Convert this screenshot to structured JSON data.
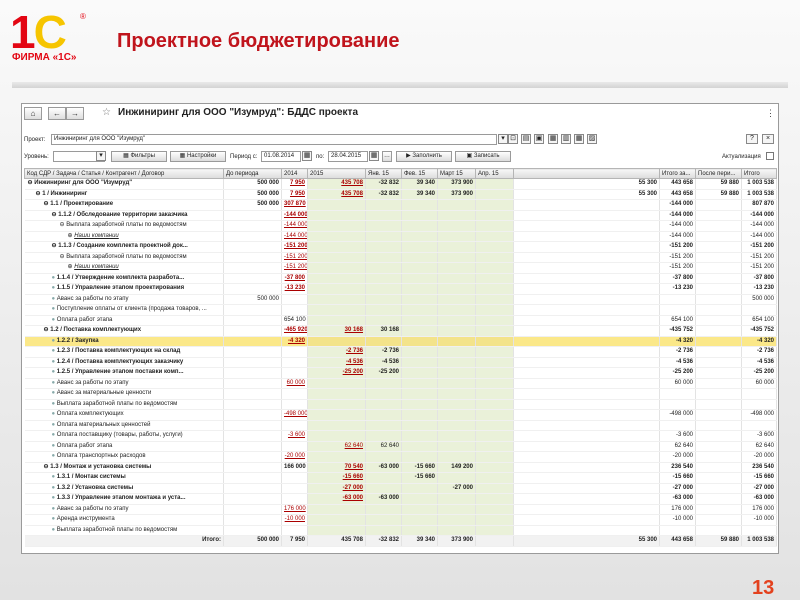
{
  "logo": {
    "mark": "1С",
    "sub": "ФИРМА «1С»"
  },
  "slide": {
    "title": "Проектное бюджетирование",
    "page": "13"
  },
  "window": {
    "title": "Инжиниринг для ООО \"Изумруд\": БДДС проекта",
    "help": "?",
    "close": "×"
  },
  "form": {
    "project_label": "Проект:",
    "project_value": "Инжиниринг для ООО \"Изумруд\"",
    "level_label": "Уровень:",
    "filters": "Фильтры",
    "settings": "Настройки",
    "period_label": "Период с:",
    "date_from": "01.08.2014",
    "date_to_label": "по:",
    "date_to": "28.04.2015",
    "fill": "Заполнить",
    "write": "Записать",
    "actual_label": "Актуализация"
  },
  "columns": [
    "Код СДР / Задача / Статья / Контрагент / Договор",
    "До периода",
    "2014",
    "2015",
    "Янв. 15",
    "Фев. 15",
    "Март 15",
    "Апр. 15",
    "",
    "Итого за...",
    "После пери...",
    "Итого"
  ],
  "rows": [
    {
      "n": "Инжиниринг для ООО \"Изумруд\"",
      "l": 0,
      "b": true,
      "v": [
        "500 000",
        "7 950",
        "435 708",
        "-32 832",
        "39 340",
        "373 900",
        "",
        "55 300",
        "443 658",
        "59 880",
        "1 003 538"
      ],
      "u": [
        false,
        true,
        true,
        false,
        false,
        false,
        false,
        false,
        false,
        false,
        false
      ]
    },
    {
      "n": "1 / Инжиниринг",
      "l": 1,
      "b": true,
      "v": [
        "500 000",
        "7 950",
        "435 708",
        "-32 832",
        "39 340",
        "373 900",
        "",
        "55 300",
        "443 658",
        "59 880",
        "1 003 538"
      ],
      "u": [
        false,
        true,
        true,
        false,
        false,
        false,
        false,
        false,
        false,
        false,
        false
      ]
    },
    {
      "n": "1.1 / Проектирование",
      "l": 2,
      "b": true,
      "v": [
        "500 000",
        "307 870",
        "",
        "",
        "",
        "",
        "",
        "",
        "-144 000",
        "",
        "807 870"
      ],
      "u": [
        false,
        true,
        false,
        false,
        false,
        false,
        false,
        false,
        false,
        false,
        false
      ]
    },
    {
      "n": "1.1.2 / Обследование территории заказчика",
      "l": 3,
      "b": true,
      "v": [
        "",
        "-144 000",
        "",
        "",
        "",
        "",
        "",
        "",
        "-144 000",
        "",
        "-144 000"
      ],
      "u": [
        false,
        true,
        false,
        false,
        false,
        false,
        false,
        false,
        false,
        false,
        false
      ]
    },
    {
      "n": "Выплата заработной платы по ведомостям",
      "l": 4,
      "b": false,
      "v": [
        "",
        "-144 000",
        "",
        "",
        "",
        "",
        "",
        "",
        "-144 000",
        "",
        "-144 000"
      ],
      "u": [
        false,
        true,
        false,
        false,
        false,
        false,
        false,
        false,
        false,
        false,
        false
      ]
    },
    {
      "n": "Наши компании",
      "l": 5,
      "b": false,
      "i": true,
      "v": [
        "",
        "-144 000",
        "",
        "",
        "",
        "",
        "",
        "",
        "-144 000",
        "",
        "-144 000"
      ],
      "u": [
        false,
        true,
        false,
        false,
        false,
        false,
        false,
        false,
        false,
        false,
        false
      ]
    },
    {
      "n": "1.1.3 / Создание комплекта проектной док...",
      "l": 3,
      "b": true,
      "v": [
        "",
        "-151 200",
        "",
        "",
        "",
        "",
        "",
        "",
        "-151 200",
        "",
        "-151 200"
      ],
      "u": [
        false,
        true,
        false,
        false,
        false,
        false,
        false,
        false,
        false,
        false,
        false
      ]
    },
    {
      "n": "Выплата заработной платы по ведомостям",
      "l": 4,
      "b": false,
      "v": [
        "",
        "-151 200",
        "",
        "",
        "",
        "",
        "",
        "",
        "-151 200",
        "",
        "-151 200"
      ],
      "u": [
        false,
        true,
        false,
        false,
        false,
        false,
        false,
        false,
        false,
        false,
        false
      ]
    },
    {
      "n": "Наши компании",
      "l": 5,
      "b": false,
      "i": true,
      "v": [
        "",
        "-151 200",
        "",
        "",
        "",
        "",
        "",
        "",
        "-151 200",
        "",
        "-151 200"
      ],
      "u": [
        false,
        true,
        false,
        false,
        false,
        false,
        false,
        false,
        false,
        false,
        false
      ]
    },
    {
      "n": "1.1.4 / Утверждение комплекта разработа...",
      "l": 3,
      "b": true,
      "v": [
        "",
        "-37 800",
        "",
        "",
        "",
        "",
        "",
        "",
        "-37 800",
        "",
        "-37 800"
      ],
      "u": [
        false,
        true,
        false,
        false,
        false,
        false,
        false,
        false,
        false,
        false,
        false
      ]
    },
    {
      "n": "1.1.5 / Управление этапом проектирования",
      "l": 3,
      "b": true,
      "v": [
        "",
        "-13 230",
        "",
        "",
        "",
        "",
        "",
        "",
        "-13 230",
        "",
        "-13 230"
      ],
      "u": [
        false,
        true,
        false,
        false,
        false,
        false,
        false,
        false,
        false,
        false,
        false
      ]
    },
    {
      "n": "Аванс за работы по этапу",
      "l": 3,
      "b": false,
      "v": [
        "500 000",
        "",
        "",
        "",
        "",
        "",
        "",
        "",
        "",
        "",
        "500 000"
      ],
      "u": [
        false,
        false,
        false,
        false,
        false,
        false,
        false,
        false,
        false,
        false,
        false
      ]
    },
    {
      "n": "Поступление оплаты от клиента (продажа товаров, ...",
      "l": 3,
      "b": false,
      "v": [
        "",
        "",
        "",
        "",
        "",
        "",
        "",
        "",
        "",
        "",
        ""
      ],
      "u": [
        false,
        false,
        false,
        false,
        false,
        false,
        false,
        false,
        false,
        false,
        false
      ]
    },
    {
      "n": "Оплата работ этапа",
      "l": 3,
      "b": false,
      "v": [
        "",
        "654 100",
        "",
        "",
        "",
        "",
        "",
        "",
        "654 100",
        "",
        "654 100"
      ],
      "u": [
        false,
        false,
        false,
        false,
        false,
        false,
        false,
        false,
        false,
        false,
        false
      ]
    },
    {
      "n": "1.2 / Поставка комплектующих",
      "l": 2,
      "b": true,
      "v": [
        "",
        "-465 920",
        "30 168",
        "30 168",
        "",
        "",
        "",
        "",
        "-435 752",
        "",
        "-435 752"
      ],
      "u": [
        false,
        true,
        true,
        false,
        false,
        false,
        false,
        false,
        false,
        false,
        false
      ]
    },
    {
      "n": "1.2.2 / Закупка",
      "l": 3,
      "b": true,
      "sel": true,
      "v": [
        "",
        "-4 320",
        "",
        "",
        "",
        "",
        "",
        "",
        "-4 320",
        "",
        "-4 320"
      ],
      "u": [
        false,
        true,
        false,
        false,
        false,
        false,
        false,
        false,
        false,
        false,
        false
      ]
    },
    {
      "n": "1.2.3 / Поставка комплектующих на склад",
      "l": 3,
      "b": true,
      "v": [
        "",
        "",
        "-2 736",
        "-2 736",
        "",
        "",
        "",
        "",
        "-2 736",
        "",
        "-2 736"
      ],
      "u": [
        false,
        false,
        true,
        false,
        false,
        false,
        false,
        false,
        false,
        false,
        false
      ]
    },
    {
      "n": "1.2.4 / Поставка комплектующих заказчику",
      "l": 3,
      "b": true,
      "v": [
        "",
        "",
        "-4 536",
        "-4 536",
        "",
        "",
        "",
        "",
        "-4 536",
        "",
        "-4 536"
      ],
      "u": [
        false,
        false,
        true,
        false,
        false,
        false,
        false,
        false,
        false,
        false,
        false
      ]
    },
    {
      "n": "1.2.5 / Управление этапом поставки комп...",
      "l": 3,
      "b": true,
      "v": [
        "",
        "",
        "-25 200",
        "-25 200",
        "",
        "",
        "",
        "",
        "-25 200",
        "",
        "-25 200"
      ],
      "u": [
        false,
        false,
        true,
        false,
        false,
        false,
        false,
        false,
        false,
        false,
        false
      ]
    },
    {
      "n": "Аванс за работы по этапу",
      "l": 3,
      "b": false,
      "v": [
        "",
        "60 000",
        "",
        "",
        "",
        "",
        "",
        "",
        "60 000",
        "",
        "60 000"
      ],
      "u": [
        false,
        true,
        false,
        false,
        false,
        false,
        false,
        false,
        false,
        false,
        false
      ]
    },
    {
      "n": "Аванс за материальные ценности",
      "l": 3,
      "b": false,
      "v": [
        "",
        "",
        "",
        "",
        "",
        "",
        "",
        "",
        "",
        "",
        ""
      ],
      "u": [
        false,
        false,
        false,
        false,
        false,
        false,
        false,
        false,
        false,
        false,
        false
      ]
    },
    {
      "n": "Выплата заработной платы по ведомостям",
      "l": 3,
      "b": false,
      "v": [
        "",
        "",
        "",
        "",
        "",
        "",
        "",
        "",
        "",
        "",
        ""
      ],
      "u": [
        false,
        false,
        false,
        false,
        false,
        false,
        false,
        false,
        false,
        false,
        false
      ]
    },
    {
      "n": "Оплата комплектующих",
      "l": 3,
      "b": false,
      "v": [
        "",
        "-498 000",
        "",
        "",
        "",
        "",
        "",
        "",
        "-498 000",
        "",
        "-498 000"
      ],
      "u": [
        false,
        true,
        false,
        false,
        false,
        false,
        false,
        false,
        false,
        false,
        false
      ]
    },
    {
      "n": "Оплата материальных ценностей",
      "l": 3,
      "b": false,
      "v": [
        "",
        "",
        "",
        "",
        "",
        "",
        "",
        "",
        "",
        "",
        ""
      ],
      "u": [
        false,
        false,
        false,
        false,
        false,
        false,
        false,
        false,
        false,
        false,
        false
      ]
    },
    {
      "n": "Оплата поставщику (товары, работы, услуги)",
      "l": 3,
      "b": false,
      "v": [
        "",
        "-3 600",
        "",
        "",
        "",
        "",
        "",
        "",
        "-3 600",
        "",
        "-3 600"
      ],
      "u": [
        false,
        true,
        false,
        false,
        false,
        false,
        false,
        false,
        false,
        false,
        false
      ]
    },
    {
      "n": "Оплата работ этапа",
      "l": 3,
      "b": false,
      "v": [
        "",
        "",
        "62 640",
        "62 640",
        "",
        "",
        "",
        "",
        "62 640",
        "",
        "62 640"
      ],
      "u": [
        false,
        false,
        true,
        false,
        false,
        false,
        false,
        false,
        false,
        false,
        false
      ]
    },
    {
      "n": "Оплата транспортных расходов",
      "l": 3,
      "b": false,
      "v": [
        "",
        "-20 000",
        "",
        "",
        "",
        "",
        "",
        "",
        "-20 000",
        "",
        "-20 000"
      ],
      "u": [
        false,
        true,
        false,
        false,
        false,
        false,
        false,
        false,
        false,
        false,
        false
      ]
    },
    {
      "n": "1.3 / Монтаж и установка системы",
      "l": 2,
      "b": true,
      "v": [
        "",
        "166 000",
        "70 540",
        "-63 000",
        "-15 660",
        "149 200",
        "",
        "",
        "236 540",
        "",
        "236 540"
      ],
      "u": [
        false,
        false,
        true,
        false,
        false,
        false,
        false,
        false,
        false,
        false,
        false
      ]
    },
    {
      "n": "1.3.1 / Монтаж системы",
      "l": 3,
      "b": true,
      "v": [
        "",
        "",
        "-15 660",
        "",
        "-15 660",
        "",
        "",
        "",
        "-15 660",
        "",
        "-15 660"
      ],
      "u": [
        false,
        false,
        true,
        false,
        false,
        false,
        false,
        false,
        false,
        false,
        false
      ]
    },
    {
      "n": "1.3.2 / Установка системы",
      "l": 3,
      "b": true,
      "v": [
        "",
        "",
        "-27 000",
        "",
        "",
        "-27 000",
        "",
        "",
        "-27 000",
        "",
        "-27 000"
      ],
      "u": [
        false,
        false,
        true,
        false,
        false,
        false,
        false,
        false,
        false,
        false,
        false
      ]
    },
    {
      "n": "1.3.3 / Управление этапом монтажа и уста...",
      "l": 3,
      "b": true,
      "v": [
        "",
        "",
        "-63 000",
        "-63 000",
        "",
        "",
        "",
        "",
        "-63 000",
        "",
        "-63 000"
      ],
      "u": [
        false,
        false,
        true,
        false,
        false,
        false,
        false,
        false,
        false,
        false,
        false
      ]
    },
    {
      "n": "Аванс за работы по этапу",
      "l": 3,
      "b": false,
      "v": [
        "",
        "176 000",
        "",
        "",
        "",
        "",
        "",
        "",
        "176 000",
        "",
        "176 000"
      ],
      "u": [
        false,
        true,
        false,
        false,
        false,
        false,
        false,
        false,
        false,
        false,
        false
      ]
    },
    {
      "n": "Аренда инструмента",
      "l": 3,
      "b": false,
      "v": [
        "",
        "-10 000",
        "",
        "",
        "",
        "",
        "",
        "",
        "-10 000",
        "",
        "-10 000"
      ],
      "u": [
        false,
        true,
        false,
        false,
        false,
        false,
        false,
        false,
        false,
        false,
        false
      ]
    },
    {
      "n": "Выплата заработной платы по ведомостям",
      "l": 3,
      "b": false,
      "v": [
        "",
        "",
        "",
        "",
        "",
        "",
        "",
        "",
        "",
        "",
        ""
      ],
      "u": [
        false,
        false,
        false,
        false,
        false,
        false,
        false,
        false,
        false,
        false,
        false
      ]
    }
  ],
  "total": {
    "label": "Итого:",
    "v": [
      "500 000",
      "7 950",
      "435 708",
      "-32 832",
      "39 340",
      "373 900",
      "",
      "55 300",
      "443 658",
      "59 880",
      "1 003 538"
    ]
  }
}
